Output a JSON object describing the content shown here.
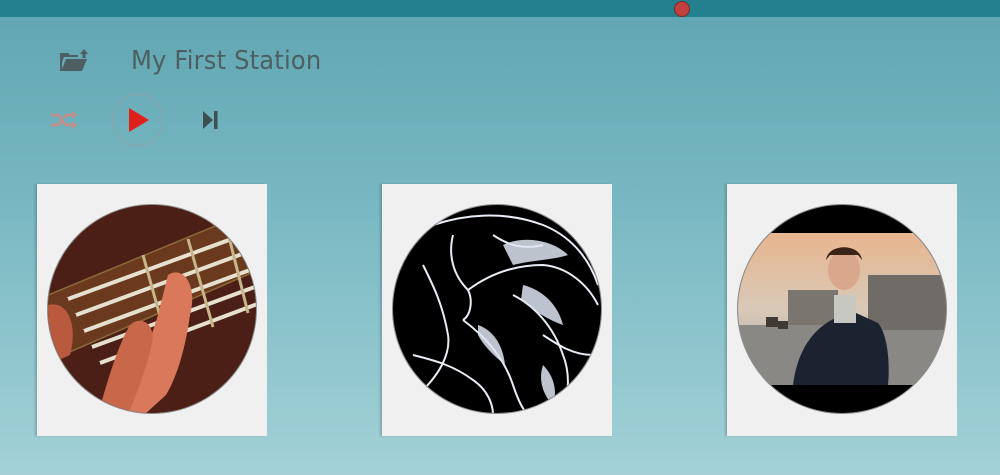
{
  "player": {
    "progress_fraction": 0.682,
    "accent_color": "#e0201a"
  },
  "header": {
    "title": "My First Station",
    "folder_icon": "folder-open-upload-icon"
  },
  "controls": {
    "shuffle_icon": "shuffle-icon",
    "play_icon": "play-icon",
    "next_icon": "skip-next-icon"
  },
  "stations": [
    {
      "artwork": "guitar-fretboard-hand"
    },
    {
      "artwork": "white-horse-sketch-on-black"
    },
    {
      "artwork": "man-on-rooftop-sunset"
    }
  ]
}
